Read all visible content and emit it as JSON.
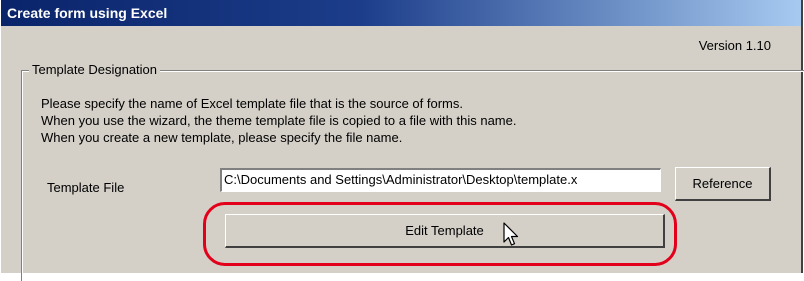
{
  "window": {
    "title": "Create form using Excel",
    "version": "Version 1.10"
  },
  "group": {
    "legend": "Template Designation",
    "lines": [
      "Please specify the name of Excel template file that is the source of forms.",
      "When you use the wizard, the theme template file is copied to a file with this name.",
      "When you create a new template, please specify the file name."
    ],
    "template_file_label": "Template File",
    "template_file_value": "C:\\Documents and Settings\\Administrator\\Desktop\\template.x",
    "reference_button": "Reference",
    "edit_button": "Edit Template"
  },
  "colors": {
    "title_bar": "#0a246a",
    "dialog_bg": "#d4d0c8",
    "highlight": "#e2001a"
  },
  "icons": {
    "cursor": "arrow-cursor-icon"
  }
}
